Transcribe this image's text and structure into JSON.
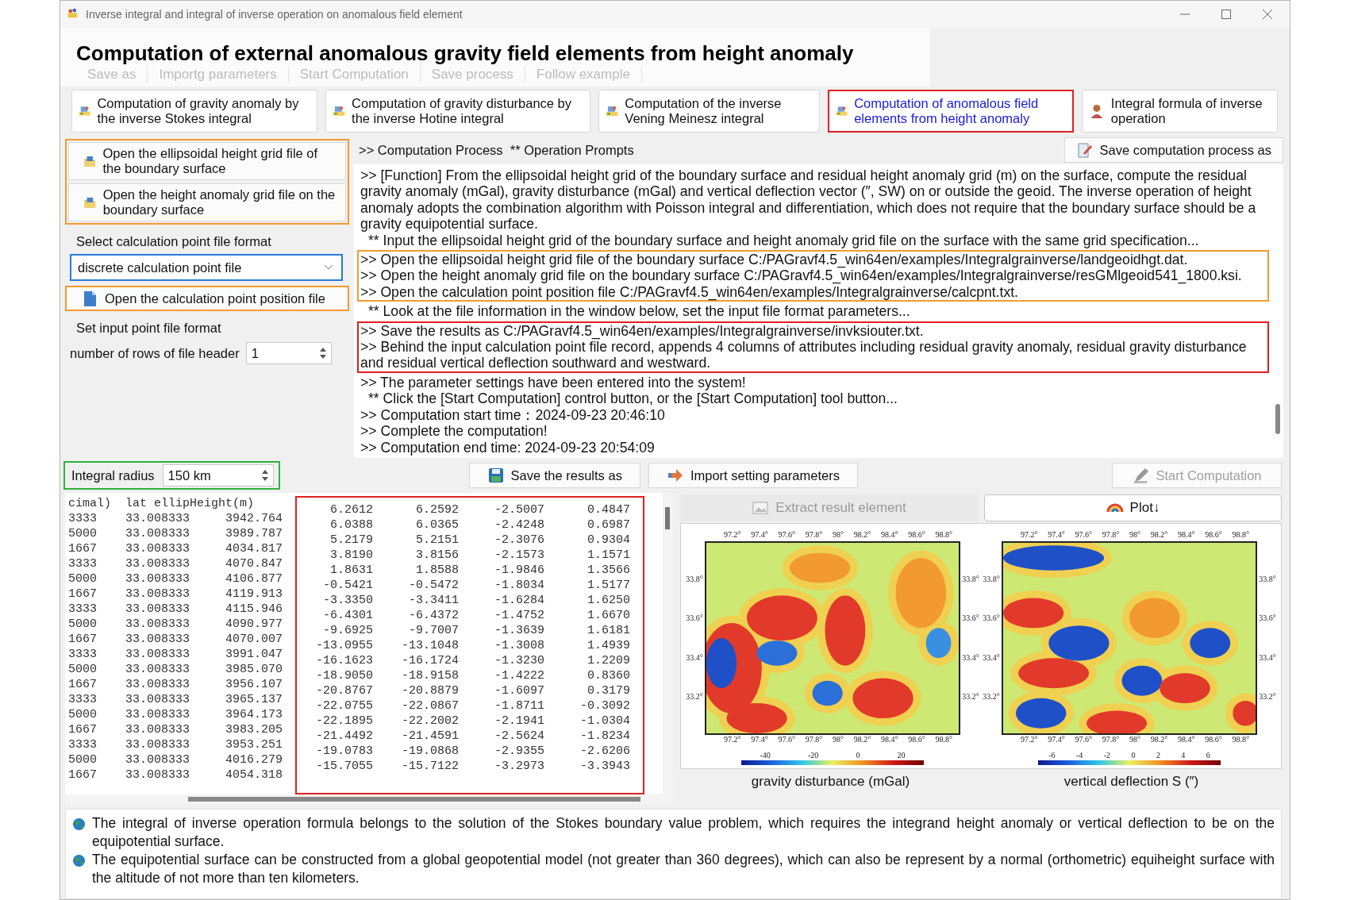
{
  "window": {
    "title": "Inverse integral and integral of inverse operation on anomalous field element"
  },
  "toolbar": [
    {
      "label": "Save as"
    },
    {
      "label": "Importg parameters"
    },
    {
      "label": "Start Computation"
    },
    {
      "label": "Save process"
    },
    {
      "label": "Follow example"
    }
  ],
  "heading": "Computation of external anomalous gravity field elements from height anomaly",
  "tabs": [
    {
      "label": "Computation of gravity anomaly by the inverse Stokes integral",
      "selected": false
    },
    {
      "label": "Computation of gravity disturbance by the inverse Hotine integral",
      "selected": false
    },
    {
      "label": "Computation of the inverse Vening Meinesz integral",
      "selected": false
    },
    {
      "label": "Computation of anomalous field elements from height anomaly",
      "selected": true
    },
    {
      "label": "Integral formula of inverse operation",
      "selected": false
    }
  ],
  "left_panel": {
    "file_buttons": [
      {
        "label": "Open the ellipsoidal height grid file of the boundary surface"
      },
      {
        "label": "Open the height anomaly grid file on the boundary surface"
      }
    ],
    "file_buttons_highlighted": true,
    "format_label": "Select calculation point file format",
    "format_select": {
      "value": "discrete calculation point file",
      "focused": true
    },
    "point_button": {
      "label": "Open the calculation point position file",
      "highlighted": true
    },
    "point_format_label": "Set input point file format",
    "header_rows": {
      "label": "number of rows of file header",
      "value": "1"
    }
  },
  "log": {
    "header": ">> Computation Process  ** Operation Prompts",
    "save_button": "Save computation process as",
    "groups": [
      {
        "highlighted": false,
        "lines": [
          {
            "kind": "prompt",
            "text": ">> [Function] From the ellipsoidal height grid of the boundary surface and residual height anomaly grid (m) on the surface, compute the residual gravity anomaly (mGal), gravity disturbance (mGal) and vertical deflection vector (″, SW) on or outside the geoid. The inverse operation of height anomaly adopts the combination algorithm with Poisson integral and differentiation, which does not require that the boundary surface should be a gravity equipotential surface."
          },
          {
            "kind": "note",
            "text": "** Input the ellipsoidal height grid of the boundary surface and height anomaly grid file on the surface with the same grid specification..."
          }
        ]
      },
      {
        "highlighted": true,
        "color": "#f39a30",
        "lines": [
          {
            "kind": "prompt",
            "text": ">> Open the ellipsoidal height grid file of the boundary surface C:/PAGravf4.5_win64en/examples/Integralgrainverse/landgeoidhgt.dat."
          },
          {
            "kind": "prompt",
            "text": ">> Open the height anomaly grid file on the boundary surface C:/PAGravf4.5_win64en/examples/Integralgrainverse/resGMlgeoid541_1800.ksi."
          },
          {
            "kind": "prompt",
            "text": ">> Open the calculation point position file C:/PAGravf4.5_win64en/examples/Integralgrainverse/calcpnt.txt."
          }
        ]
      },
      {
        "highlighted": false,
        "lines": [
          {
            "kind": "note",
            "text": "** Look at the file information in the window below, set the input file format parameters..."
          }
        ]
      },
      {
        "highlighted": true,
        "color": "#e02020",
        "lines": [
          {
            "kind": "prompt",
            "text": ">> Save the results as C:/PAGravf4.5_win64en/examples/Integralgrainverse/invksiouter.txt."
          },
          {
            "kind": "prompt",
            "text": ">> Behind the input calculation point file record, appends 4 columns of attributes including residual gravity anomaly, residual gravity disturbance and residual vertical deflection southward and westward."
          }
        ]
      },
      {
        "highlighted": false,
        "lines": [
          {
            "kind": "prompt",
            "text": ">> The parameter settings have been entered into the system!"
          },
          {
            "kind": "note",
            "text": "** Click the [Start Computation] control button, or the [Start Computation] tool button..."
          },
          {
            "kind": "prompt",
            "text": ">> Computation start time：2024-09-23 20:46:10"
          },
          {
            "kind": "prompt",
            "text": ">> Complete the computation!"
          },
          {
            "kind": "prompt",
            "text": ">> Computation end time: 2024-09-23 20:54:09"
          }
        ]
      }
    ]
  },
  "radius": {
    "label": "Integral radius",
    "value": "150 km",
    "highlighted": true
  },
  "actions": [
    {
      "label": "Save the results as",
      "disabled": false
    },
    {
      "label": "Import setting parameters",
      "disabled": false
    },
    {
      "label": "Start Computation",
      "disabled": true
    }
  ],
  "file_view": {
    "header": "cimal)  lat ellipHeight(m)",
    "results_highlighted": true,
    "rows": [
      {
        "point": [
          "3333",
          "33.008333",
          "3942.764"
        ],
        "results": [
          "6.2612",
          "6.2592",
          "-2.5007",
          "0.4847"
        ]
      },
      {
        "point": [
          "5000",
          "33.008333",
          "3989.787"
        ],
        "results": [
          "6.0388",
          "6.0365",
          "-2.4248",
          "0.6987"
        ]
      },
      {
        "point": [
          "1667",
          "33.008333",
          "4034.817"
        ],
        "results": [
          "5.2179",
          "5.2151",
          "-2.3076",
          "0.9304"
        ]
      },
      {
        "point": [
          "3333",
          "33.008333",
          "4070.847"
        ],
        "results": [
          "3.8190",
          "3.8156",
          "-2.1573",
          "1.1571"
        ]
      },
      {
        "point": [
          "5000",
          "33.008333",
          "4106.877"
        ],
        "results": [
          "1.8631",
          "1.8588",
          "-1.9846",
          "1.3566"
        ]
      },
      {
        "point": [
          "1667",
          "33.008333",
          "4119.913"
        ],
        "results": [
          "-0.5421",
          "-0.5472",
          "-1.8034",
          "1.5177"
        ]
      },
      {
        "point": [
          "3333",
          "33.008333",
          "4115.946"
        ],
        "results": [
          "-3.3350",
          "-3.3411",
          "-1.6284",
          "1.6250"
        ]
      },
      {
        "point": [
          "5000",
          "33.008333",
          "4090.977"
        ],
        "results": [
          "-6.4301",
          "-6.4372",
          "-1.4752",
          "1.6670"
        ]
      },
      {
        "point": [
          "1667",
          "33.008333",
          "4070.007"
        ],
        "results": [
          "-9.6925",
          "-9.7007",
          "-1.3639",
          "1.6181"
        ]
      },
      {
        "point": [
          "3333",
          "33.008333",
          "3991.047"
        ],
        "results": [
          "-13.0955",
          "-13.1048",
          "-1.3008",
          "1.4939"
        ]
      },
      {
        "point": [
          "5000",
          "33.008333",
          "3985.070"
        ],
        "results": [
          "-16.1623",
          "-16.1724",
          "-1.3230",
          "1.2209"
        ]
      },
      {
        "point": [
          "1667",
          "33.008333",
          "3956.107"
        ],
        "results": [
          "-18.9050",
          "-18.9158",
          "-1.4222",
          "0.8360"
        ]
      },
      {
        "point": [
          "3333",
          "33.008333",
          "3965.137"
        ],
        "results": [
          "-20.8767",
          "-20.8879",
          "-1.6097",
          "0.3179"
        ]
      },
      {
        "point": [
          "5000",
          "33.008333",
          "3964.173"
        ],
        "results": [
          "-22.0755",
          "-22.0867",
          "-1.8711",
          "-0.3092"
        ]
      },
      {
        "point": [
          "1667",
          "33.008333",
          "3983.205"
        ],
        "results": [
          "-22.1895",
          "-22.2002",
          "-2.1941",
          "-1.0304"
        ]
      },
      {
        "point": [
          "3333",
          "33.008333",
          "3953.251"
        ],
        "results": [
          "-21.4492",
          "-21.4591",
          "-2.5624",
          "-1.8234"
        ]
      },
      {
        "point": [
          "5000",
          "33.008333",
          "4016.279"
        ],
        "results": [
          "-19.0783",
          "-19.0868",
          "-2.9355",
          "-2.6206"
        ]
      },
      {
        "point": [
          "1667",
          "33.008333",
          "4054.318"
        ],
        "results": [
          "-15.7055",
          "-15.7122",
          "-3.2973",
          "-3.3943"
        ]
      }
    ]
  },
  "plot_tabs": [
    {
      "label": "Extract result element",
      "selected": false,
      "disabled": true
    },
    {
      "label": "Plot↓",
      "selected": true,
      "disabled": false
    }
  ],
  "maps": [
    {
      "caption": "gravity disturbance (mGal)",
      "x_ticks_top": [
        "97.2°",
        "97.4°",
        "97.6°",
        "97.8°",
        "98°",
        "98.2°",
        "98.4°",
        "98.6°",
        "98.8°"
      ],
      "y_ticks_left": [
        "33.8°",
        "33.6°",
        "33.4°",
        "33.2°"
      ],
      "y_ticks_right": [
        "33.8°",
        "33.6°",
        "33.4°",
        "33.2°"
      ],
      "x_ticks_bottom": [
        "97.2°",
        "97.4°",
        "97.6°",
        "97.8°",
        "98°",
        "98.2°",
        "98.4°",
        "98.6°",
        "98.8°"
      ],
      "colorbar_ticks": [
        "-40",
        "-20",
        "0",
        "20"
      ]
    },
    {
      "caption": "vertical deflection S (″)",
      "x_ticks_top": [
        "97.2°",
        "97.4°",
        "97.6°",
        "97.8°",
        "98°",
        "98.2°",
        "98.4°",
        "98.6°",
        "98.8°"
      ],
      "y_ticks_left": [
        "33.8°",
        "33.6°",
        "33.4°",
        "33.2°"
      ],
      "y_ticks_right": [
        "33.8°",
        "33.6°",
        "33.4°",
        "33.2°"
      ],
      "x_ticks_bottom": [
        "97.2°",
        "97.4°",
        "97.6°",
        "97.8°",
        "98°",
        "98.2°",
        "98.4°",
        "98.6°",
        "98.8°"
      ],
      "colorbar_ticks": [
        "-6",
        "-4",
        "-2",
        "0",
        "2",
        "4",
        "6"
      ]
    }
  ],
  "notes": [
    "The integral of inverse operation formula belongs to the solution of the Stokes boundary value problem, which requires the integrand height anomaly or vertical deflection to be on the equipotential surface.",
    "The equipotential surface can be constructed from a global geopotential model (not greater than 360 degrees), which can also be represent by a normal (orthometric) equiheight surface with the altitude of not more than ten kilometers."
  ]
}
